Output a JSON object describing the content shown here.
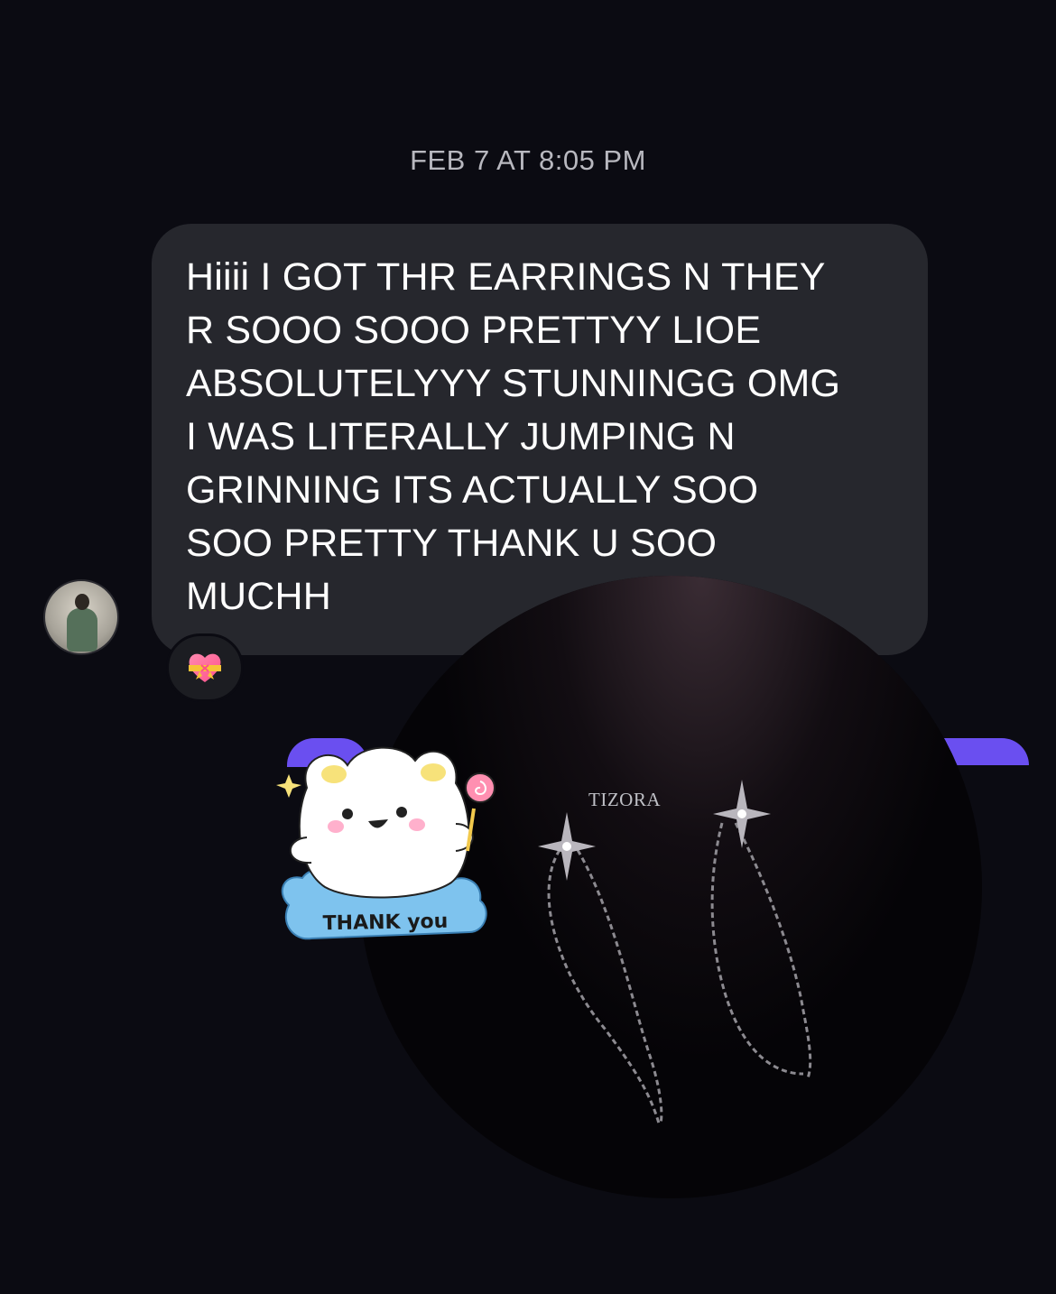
{
  "conversation": {
    "timestamp": "FEB 7 AT 8:05 PM",
    "message": {
      "text": "Hiiii I GOT THR EARRINGS N THEY\nR SOOO SOOO PRETTYY LIOE\nABSOLUTELYYY STUNNINGG OMG\nI WAS LITERALLY JUMPING N\nGRINNING ITS ACTUALLY SOO\nSOO PRETTY THANK U SOO\nMUCHH",
      "reaction_icon": "heart-with-ribbon-icon"
    },
    "sticker": {
      "label": "THANK you",
      "icon": "thank-you-bunny-sticker"
    },
    "photo": {
      "brand": "TIZORA",
      "subject": "earrings-photo"
    }
  },
  "colors": {
    "background": "#0b0b12",
    "bubble": "#26272d",
    "accent_purple": "#6a4ff0",
    "timestamp": "#b8b8bf"
  }
}
